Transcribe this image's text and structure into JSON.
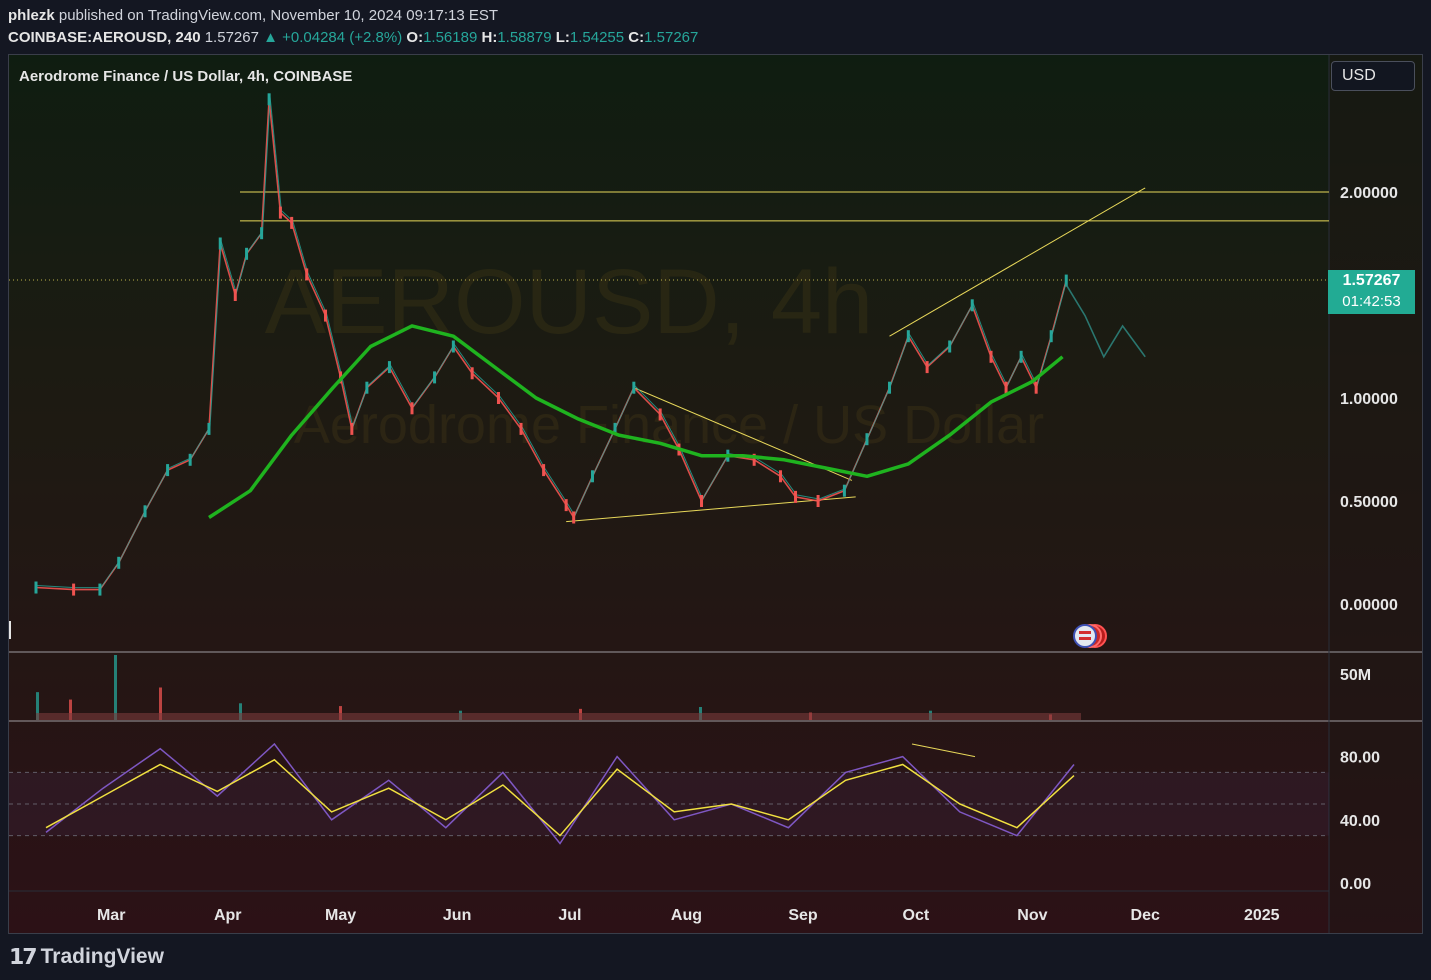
{
  "header": {
    "publisher": "phlezk",
    "published_text": "published on TradingView.com, November 10, 2024 09:17:13 EST",
    "symbol": "COINBASE:AEROUSD, 240",
    "last": "1.57267",
    "change": "▲ +0.04284 (+2.8%)",
    "o_label": "O:",
    "o": "1.56189",
    "h_label": "H:",
    "h": "1.58879",
    "l_label": "L:",
    "l": "1.54255",
    "c_label": "C:",
    "c": "1.57267"
  },
  "legend": "Aerodrome Finance / US Dollar, 4h, COINBASE",
  "currency_button": "USD",
  "price_tag": {
    "price": "1.57267",
    "countdown": "01:42:53"
  },
  "watermark": {
    "line1": "AEROUSD, 4h",
    "line2": "Aerodrome Finance / US Dollar"
  },
  "footer_logo": "TradingView",
  "colors": {
    "up": "#26a69a",
    "down": "#ef5350",
    "ma": "#1fb31f",
    "drawing": "#e8d85a",
    "rsi": "#7e57c2",
    "rsi_ma": "#f0e040",
    "pricetag": "#22ab94"
  },
  "chart_data": [
    {
      "type": "line",
      "title": "Aerodrome Finance / US Dollar, 4h, COINBASE",
      "y_scale": "power",
      "y_ticks": [
        {
          "label": "2.00000",
          "value": 2.0
        },
        {
          "label": "1.00000",
          "value": 1.0
        },
        {
          "label": "0.50000",
          "value": 0.5
        },
        {
          "label": "0.00000",
          "value": 0.0
        }
      ],
      "x_ticks": [
        "Mar",
        "Apr",
        "May",
        "Jun",
        "Jul",
        "Aug",
        "Sep",
        "Oct",
        "Nov",
        "Dec",
        "2025"
      ],
      "series": [
        {
          "x": [
            "2024-02-10",
            "2024-02-20",
            "2024-02-27",
            "2024-03-03",
            "2024-03-10",
            "2024-03-16",
            "2024-03-22",
            "2024-03-27",
            "2024-03-30",
            "2024-04-03",
            "2024-04-06",
            "2024-04-10",
            "2024-04-12",
            "2024-04-15",
            "2024-04-18",
            "2024-04-22",
            "2024-04-27",
            "2024-05-01",
            "2024-05-04",
            "2024-05-08",
            "2024-05-14",
            "2024-05-20",
            "2024-05-26",
            "2024-05-31",
            "2024-06-05",
            "2024-06-12",
            "2024-06-18",
            "2024-06-24",
            "2024-06-30",
            "2024-07-02",
            "2024-07-07",
            "2024-07-13",
            "2024-07-18",
            "2024-07-25",
            "2024-07-30",
            "2024-08-05",
            "2024-08-12",
            "2024-08-19",
            "2024-08-26",
            "2024-08-30",
            "2024-09-05",
            "2024-09-12",
            "2024-09-18",
            "2024-09-24",
            "2024-09-29",
            "2024-10-04",
            "2024-10-10",
            "2024-10-16",
            "2024-10-21",
            "2024-10-25",
            "2024-10-29",
            "2024-11-02",
            "2024-11-06",
            "2024-11-10"
          ],
          "y": [
            0.08,
            0.07,
            0.07,
            0.2,
            0.45,
            0.65,
            0.7,
            0.85,
            1.75,
            1.5,
            1.7,
            1.8,
            2.45,
            1.9,
            1.85,
            1.6,
            1.4,
            1.1,
            0.85,
            1.05,
            1.15,
            0.95,
            1.1,
            1.25,
            1.12,
            1.0,
            0.85,
            0.65,
            0.48,
            0.42,
            0.62,
            0.85,
            1.05,
            0.92,
            0.75,
            0.5,
            0.72,
            0.7,
            0.62,
            0.52,
            0.5,
            0.55,
            0.8,
            1.05,
            1.3,
            1.15,
            1.25,
            1.45,
            1.2,
            1.05,
            1.2,
            1.05,
            1.3,
            1.57
          ]
        },
        {
          "name": "Moving average",
          "x": [
            "2024-03-27",
            "2024-04-07",
            "2024-04-18",
            "2024-04-29",
            "2024-05-09",
            "2024-05-20",
            "2024-05-31",
            "2024-06-11",
            "2024-06-22",
            "2024-07-03",
            "2024-07-14",
            "2024-07-25",
            "2024-08-05",
            "2024-08-16",
            "2024-08-27",
            "2024-09-07",
            "2024-09-18",
            "2024-09-29",
            "2024-10-10",
            "2024-10-21",
            "2024-11-01",
            "2024-11-09"
          ],
          "y": [
            0.42,
            0.55,
            0.82,
            1.05,
            1.25,
            1.35,
            1.3,
            1.15,
            1.0,
            0.9,
            0.82,
            0.78,
            0.72,
            0.72,
            0.7,
            0.66,
            0.62,
            0.68,
            0.82,
            0.98,
            1.08,
            1.2
          ]
        },
        {
          "name": "Projection",
          "x": [
            "2024-11-10",
            "2024-11-15",
            "2024-11-20",
            "2024-11-25",
            "2024-12-01"
          ],
          "y": [
            1.55,
            1.4,
            1.2,
            1.35,
            1.2
          ]
        }
      ],
      "levels": [
        2.0,
        1.86
      ],
      "last_price": 1.57267
    },
    {
      "type": "bar",
      "title": "Volume",
      "y_ticks": [
        {
          "label": "50M",
          "value": 50
        }
      ],
      "x": [
        "Feb",
        "Mar",
        "Mar",
        "Apr",
        "Apr",
        "May",
        "Jun",
        "Jul",
        "Aug",
        "Sep",
        "Oct",
        "Nov"
      ],
      "values": [
        30,
        22,
        70,
        35,
        18,
        15,
        10,
        12,
        14,
        8,
        10,
        6
      ]
    },
    {
      "type": "line",
      "title": "RSI",
      "y_ticks": [
        {
          "label": "80.00",
          "value": 80
        },
        {
          "label": "40.00",
          "value": 40
        },
        {
          "label": "0.00",
          "value": 0
        }
      ],
      "ylim": [
        0,
        100
      ],
      "bands": [
        70,
        50,
        30
      ],
      "series": [
        {
          "name": "RSI",
          "x": [
            "Feb",
            "Mar",
            "Mar",
            "Apr",
            "Apr",
            "May",
            "May",
            "Jun",
            "Jun",
            "Jul",
            "Jul",
            "Aug",
            "Aug",
            "Sep",
            "Sep",
            "Oct",
            "Oct",
            "Nov",
            "Nov"
          ],
          "y": [
            32,
            60,
            85,
            55,
            88,
            40,
            65,
            35,
            70,
            25,
            80,
            40,
            50,
            35,
            70,
            80,
            45,
            30,
            75
          ]
        },
        {
          "name": "RSI MA",
          "x": [
            "Feb",
            "Mar",
            "Mar",
            "Apr",
            "Apr",
            "May",
            "May",
            "Jun",
            "Jun",
            "Jul",
            "Jul",
            "Aug",
            "Aug",
            "Sep",
            "Sep",
            "Oct",
            "Oct",
            "Nov",
            "Nov"
          ],
          "y": [
            35,
            55,
            75,
            58,
            78,
            45,
            60,
            40,
            62,
            30,
            72,
            45,
            50,
            40,
            65,
            75,
            50,
            35,
            68
          ]
        }
      ]
    }
  ]
}
